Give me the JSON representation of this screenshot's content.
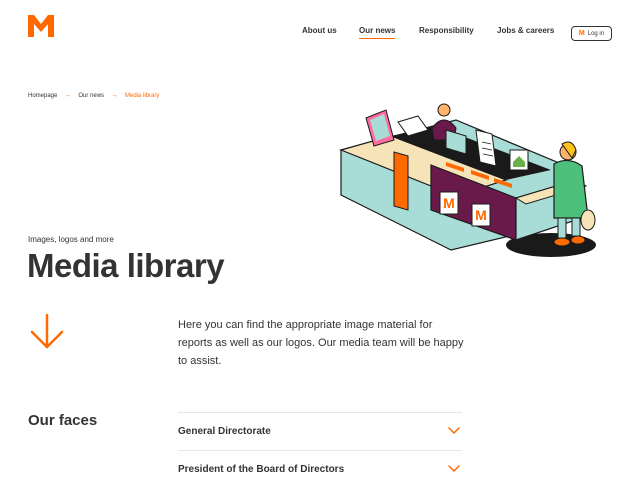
{
  "brand": {
    "logo_letter": "M",
    "accent": "#ff6a00",
    "text": "#333333"
  },
  "nav": {
    "items": [
      {
        "label": "About us",
        "active": false
      },
      {
        "label": "Our news",
        "active": true
      },
      {
        "label": "Responsibility",
        "active": false
      },
      {
        "label": "Jobs & careers",
        "active": false
      }
    ],
    "login": {
      "icon_letter": "M",
      "label": "Log in"
    }
  },
  "breadcrumb": {
    "items": [
      "Homepage",
      "Our news",
      "Media library"
    ]
  },
  "hero": {
    "eyebrow": "Images, logos and more",
    "title": "Media library"
  },
  "intro": {
    "text": "Here you can find the appropriate image material for reports as well as our logos. Our media team will be happy to assist."
  },
  "faces": {
    "title": "Our faces",
    "items": [
      {
        "label": "General Directorate",
        "icon": "chevron-down-icon"
      },
      {
        "label": "President of the Board of Directors",
        "icon": "chevron-down-icon"
      }
    ]
  },
  "illustration": {
    "sign_letter": "M"
  }
}
